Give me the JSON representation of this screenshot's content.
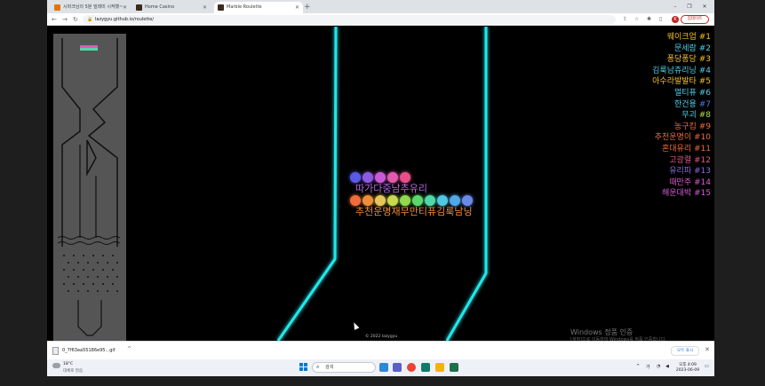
{
  "browser": {
    "tabs": [
      {
        "label": "시마크님의 5분 밀레미 시작했~",
        "favicon_color": "#e37400",
        "active": false
      },
      {
        "label": "Home Casino",
        "favicon_color": "#3c2a1a",
        "active": false
      },
      {
        "label": "Marble Roulette",
        "favicon_color": "#3c2a1a",
        "active": true
      }
    ],
    "new_tab": "+",
    "window_controls": [
      "–",
      "❐",
      "✕"
    ],
    "url": "lazygyu.github.io/roulette/",
    "update_button": "업데이트",
    "avatar_letter": "K"
  },
  "game": {
    "ranking": [
      {
        "name": "웨이크업",
        "rank": "#1",
        "name_color": "#f5c518",
        "rank_color": "#f5c518"
      },
      {
        "name": "문세람",
        "rank": "#2",
        "name_color": "#4fd1e8",
        "rank_color": "#4fd1e8"
      },
      {
        "name": "퐁당퐁당",
        "rank": "#3",
        "name_color": "#f5c518",
        "rank_color": "#f5c518"
      },
      {
        "name": "김룩남쥬리닝",
        "rank": "#4",
        "name_color": "#4fd1e8",
        "rank_color": "#4fd1e8"
      },
      {
        "name": "아수라발발타",
        "rank": "#5",
        "name_color": "#f5c518",
        "rank_color": "#f5c518"
      },
      {
        "name": "멀티퓨",
        "rank": "#6",
        "name_color": "#4fd1e8",
        "rank_color": "#4fd1e8"
      },
      {
        "name": "한건용",
        "rank": "#7",
        "name_color": "#4fd1e8",
        "rank_color": "#4a7bdc"
      },
      {
        "name": "무괴",
        "rank": "#8",
        "name_color": "#4fd1e8",
        "rank_color": "#b7e04a"
      },
      {
        "name": "농구킴",
        "rank": "#9",
        "name_color": "#ef6c3a",
        "rank_color": "#ef6c3a"
      },
      {
        "name": "추천운명이",
        "rank": "#10",
        "name_color": "#ef6c3a",
        "rank_color": "#ef6c3a"
      },
      {
        "name": "혼대유리",
        "rank": "#11",
        "name_color": "#ef6c3a",
        "rank_color": "#ef6c3a"
      },
      {
        "name": "고광렬",
        "rank": "#12",
        "name_color": "#e05a8a",
        "rank_color": "#e05a8a"
      },
      {
        "name": "유리파",
        "rank": "#13",
        "name_color": "#8b6ae0",
        "rank_color": "#8b6ae0"
      },
      {
        "name": "때만주",
        "rank": "#14",
        "name_color": "#e05ad0",
        "rank_color": "#e05ad0"
      },
      {
        "name": "해운대박",
        "rank": "#15",
        "name_color": "#d85ad8",
        "rank_color": "#d85ad8"
      }
    ],
    "upper_balls": [
      "#5a5ae8",
      "#8b5ae0",
      "#c85ad8",
      "#e05ab0",
      "#e8508a"
    ],
    "lower_balls": [
      "#ef6c3a",
      "#f08c3a",
      "#e8c55a",
      "#c8d850",
      "#90d850",
      "#5ad86a",
      "#50d8a8",
      "#50c8e0",
      "#50a8e8",
      "#6a8ae8"
    ],
    "upper_label": "따가다중남추유리",
    "upper_label_color": "#b36ae0",
    "lower_label": "추천운명재무만티퓨김룩남닝",
    "lower_label_color": "#ef8c3a",
    "copyright": "© 2022 lazygyu"
  },
  "windows_activation": {
    "title": "Windows 정품 인증",
    "desc": "[설정]으로 이동하여 Windows를 정품 인증합니다."
  },
  "download_bar": {
    "filename": "0_7f63ea55186e95...gif",
    "chevron": "^",
    "show_all": "모두 표시",
    "close": "✕"
  },
  "taskbar": {
    "weather_temp": "18°C",
    "weather_desc": "대체로 맑음",
    "search_placeholder": "검색",
    "tray_chevron": "^",
    "tray_lang": "가",
    "clock_time": "오후 4:09",
    "clock_date": "2023-06-09"
  },
  "colors": {
    "wall_glow": "#23e6ea",
    "minimap_bg": "#555555"
  }
}
